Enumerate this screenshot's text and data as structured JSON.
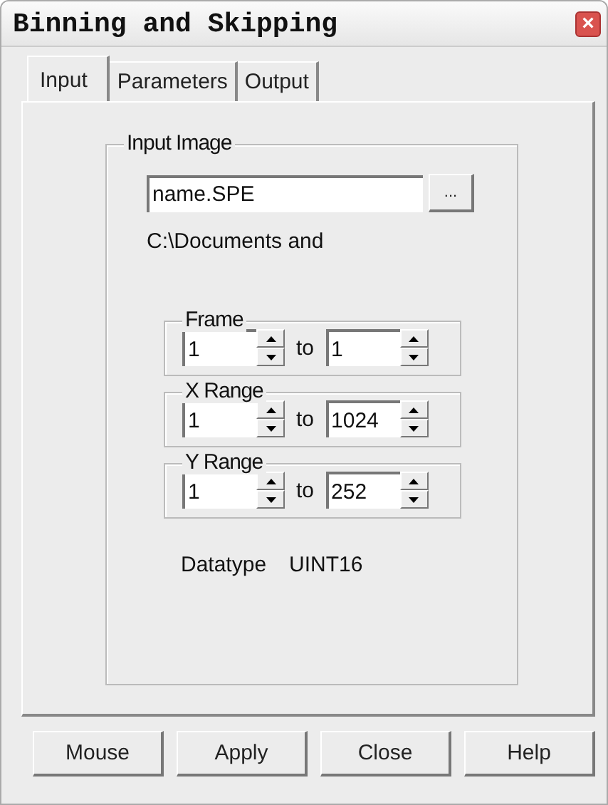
{
  "window": {
    "title": "Binning and Skipping",
    "close": "×"
  },
  "tabs": [
    {
      "label": "Input",
      "selected": true
    },
    {
      "label": "Parameters",
      "selected": false
    },
    {
      "label": "Output",
      "selected": false
    }
  ],
  "input_image": {
    "label": "Input Image",
    "value": "name.SPE",
    "browse": "...",
    "path": "C:\\Documents and"
  },
  "ranges": [
    {
      "label": "Frame",
      "from": "1",
      "to_label": "to",
      "to": "1"
    },
    {
      "label": "X Range",
      "from": "1",
      "to_label": "to",
      "to": "1024"
    },
    {
      "label": "Y Range",
      "from": "1",
      "to_label": "to",
      "to": "252"
    }
  ],
  "datatype": {
    "label": "Datatype",
    "value": "UINT16"
  },
  "buttons": [
    "Mouse",
    "Apply",
    "Close",
    "Help"
  ]
}
